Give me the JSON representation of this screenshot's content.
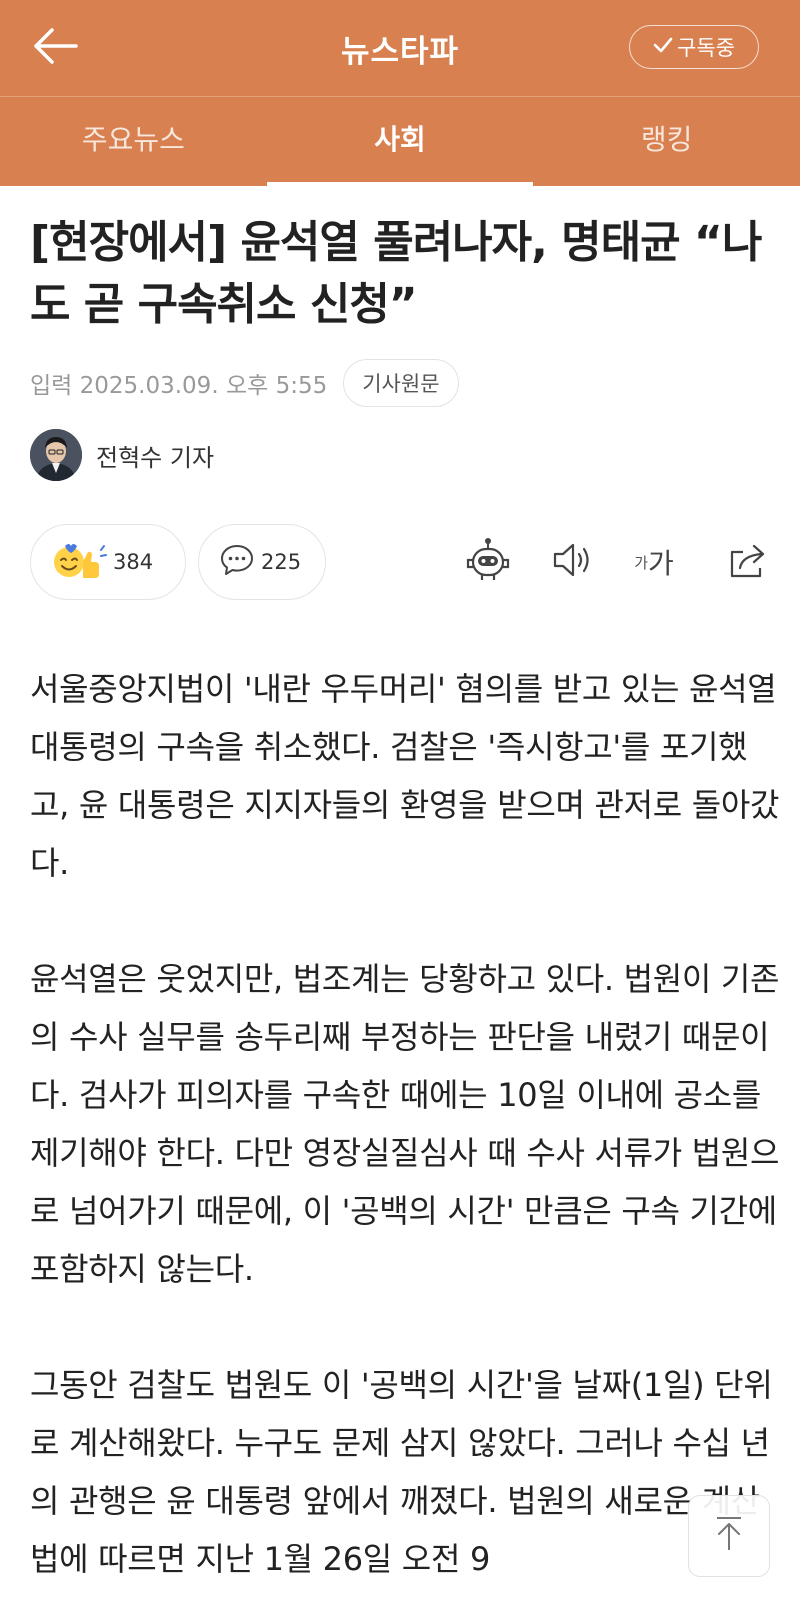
{
  "header": {
    "app_title": "뉴스타파",
    "subscribe_label": "구독중"
  },
  "tabs": [
    {
      "label": "주요뉴스"
    },
    {
      "label": "사회"
    },
    {
      "label": "랭킹"
    }
  ],
  "article": {
    "title": "[현장에서] 윤석열 풀려나자, 명태균 “나도 곧 구속취소 신청”",
    "date": "입력 2025.03.09. 오후 5:55",
    "source_button": "기사원문",
    "author": "전혁수 기자",
    "reactions_count": "384",
    "comments_count": "225",
    "font_small": "가",
    "font_big": "가",
    "paragraphs": [
      "서울중앙지법이 '내란 우두머리' 혐의를 받고 있는 윤석열 대통령의 구속을 취소했다. 검찰은 '즉시항고'를 포기했고, 윤 대통령은 지지자들의 환영을 받으며 관저로 돌아갔다.",
      "윤석열은 웃었지만, 법조계는 당황하고 있다. 법원이 기존의 수사 실무를 송두리째 부정하는 판단을 내렸기 때문이다. 검사가 피의자를 구속한 때에는 10일 이내에 공소를 제기해야 한다. 다만 영장실질심사 때 수사 서류가 법원으로 넘어가기 때문에, 이 '공백의 시간' 만큼은 구속 기간에 포함하지 않는다.",
      "그동안 검찰도 법원도 이 '공백의 시간'을 날짜(1일) 단위로 계산해왔다. 누구도 문제 삼지 않았다. 그러나 수십 년의 관행은 윤 대통령 앞에서 깨졌다. 법원의 새로운 계산법에 따르면 지난 1월 26일 오전 9"
    ]
  },
  "colors": {
    "header_bg": "#d8804f"
  }
}
